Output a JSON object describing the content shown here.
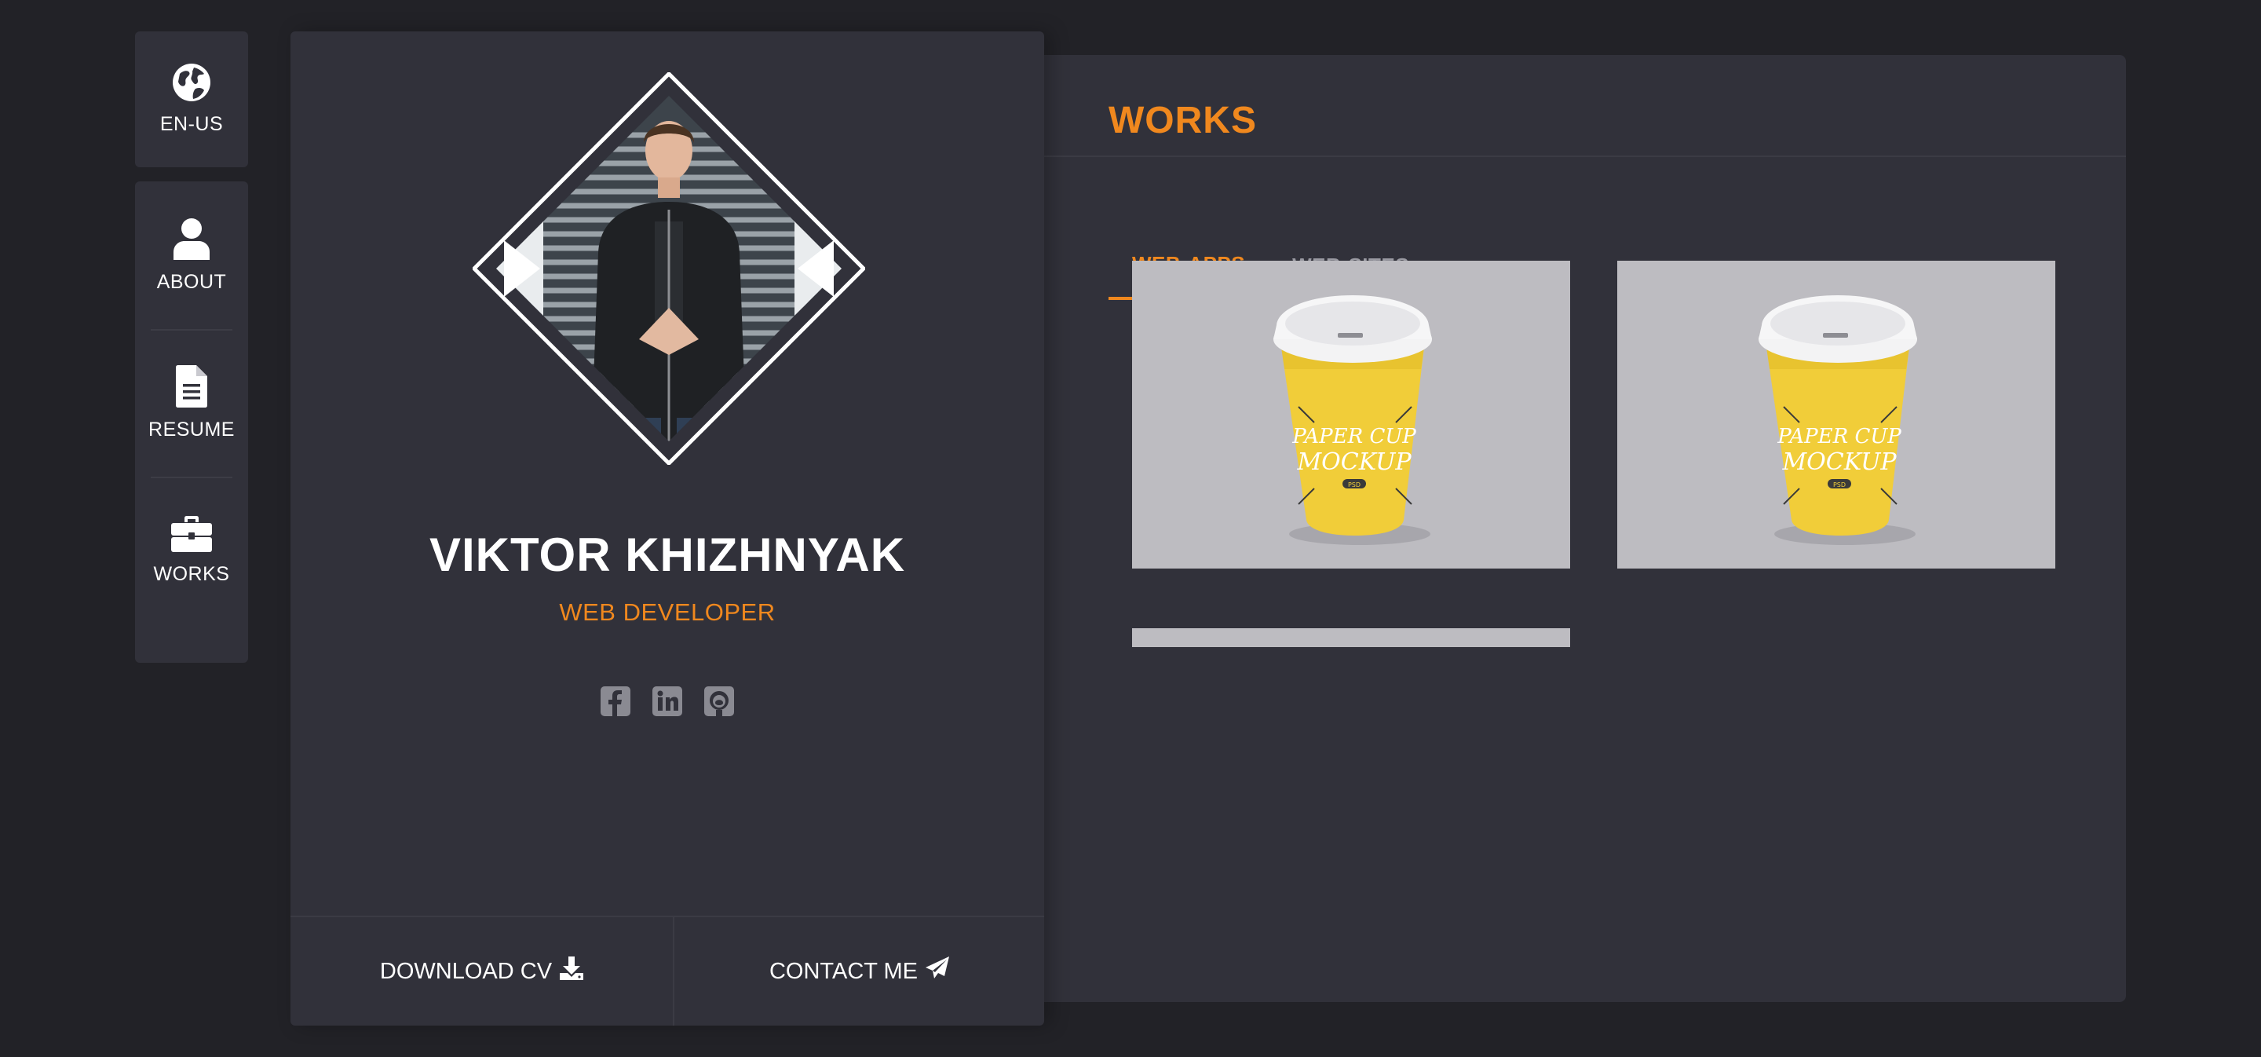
{
  "lang": {
    "label": "EN-US",
    "icon": "globe-icon"
  },
  "nav": {
    "items": [
      {
        "label": "ABOUT",
        "icon": "user-icon"
      },
      {
        "label": "RESUME",
        "icon": "document-icon"
      },
      {
        "label": "WORKS",
        "icon": "briefcase-icon"
      }
    ]
  },
  "profile": {
    "name": "VIKTOR KHIZHNYAK",
    "role": "WEB DEVELOPER",
    "socials": [
      "facebook-icon",
      "linkedin-icon",
      "github-icon"
    ],
    "download_label": "DOWNLOAD CV",
    "contact_label": "CONTACT ME"
  },
  "works": {
    "title": "WORKS",
    "tabs": [
      {
        "label": "WEB-APPS",
        "active": true
      },
      {
        "label": "WEB-SITES",
        "active": false
      }
    ],
    "mockup_text_1": "PAPER CUP",
    "mockup_text_2": "MOCKUP",
    "mockup_badge": "PSD"
  },
  "colors": {
    "accent": "#f0881e",
    "panel": "#31313a",
    "background": "#222227",
    "cup": "#f1cd39"
  }
}
